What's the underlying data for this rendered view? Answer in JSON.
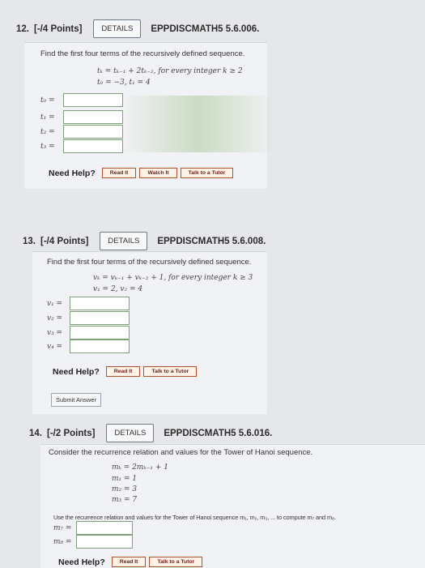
{
  "q12": {
    "number": "12.",
    "points": "[-/4 Points]",
    "details": "DETAILS",
    "code": "EPPDISCMATH5 5.6.006.",
    "prompt": "Find the first four terms of the recursively defined sequence.",
    "rec_line1": "tₖ = tₖ₋₁ + 2tₖ₋₂, for every integer k ≥ 2",
    "rec_line2": "t₀ = −3, t₁ = 4",
    "labels": [
      "t₀ =",
      "t₁ =",
      "t₂ =",
      "t₃ ="
    ],
    "values": [
      "",
      "",
      "",
      ""
    ],
    "help": "Need Help?",
    "buttons": [
      "Read It",
      "Watch It",
      "Talk to a Tutor"
    ]
  },
  "q13": {
    "number": "13.",
    "points": "[-/4 Points]",
    "details": "DETAILS",
    "code": "EPPDISCMATH5 5.6.008.",
    "prompt": "Find the first four terms of the recursively defined sequence.",
    "rec_line1": "vₖ = vₖ₋₁ + vₖ₋₂ + 1, for every integer k ≥ 3",
    "rec_line2": "v₁ = 2, v₂ = 4",
    "labels": [
      "v₁ =",
      "v₂ =",
      "v₃ =",
      "v₄ ="
    ],
    "values": [
      "",
      "",
      "",
      ""
    ],
    "help": "Need Help?",
    "buttons": [
      "Read It",
      "Talk to a Tutor"
    ],
    "submit": "Submit Answer"
  },
  "q14": {
    "number": "14.",
    "points": "[-/2 Points]",
    "details": "DETAILS",
    "code": "EPPDISCMATH5 5.6.016.",
    "prompt": "Consider the recurrence relation and values for the Tower of Hanoi sequence.",
    "rec_lines": [
      "mₖ = 2mₖ₋₁ + 1",
      "m₁ = 1",
      "m₂ = 3",
      "m₃ = 7"
    ],
    "instruction": "Use the recurrence relation and values for the Tower of Hanoi sequence m₁, m₂, m₃, ... to compute m₇ and m₈.",
    "labels": [
      "m₇ =",
      "m₈ ="
    ],
    "values": [
      "",
      ""
    ],
    "help": "Need Help?",
    "buttons": [
      "Read It",
      "Talk to a Tutor"
    ]
  }
}
